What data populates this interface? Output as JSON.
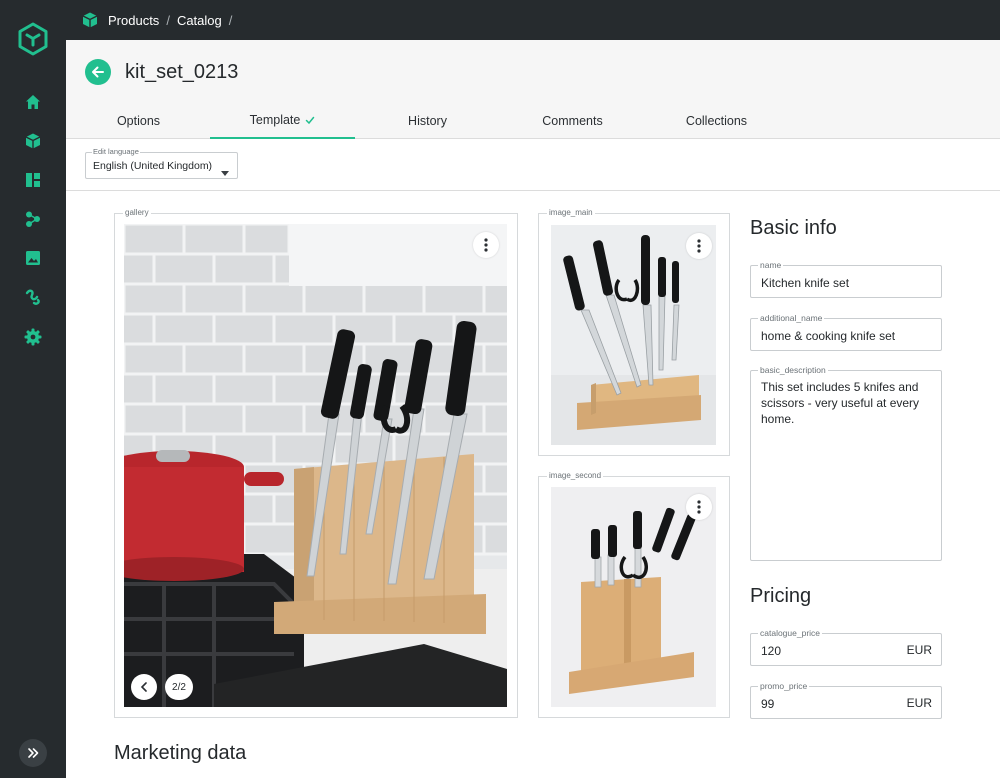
{
  "colors": {
    "sidebar": "#262b2e",
    "accent": "#21bf8f"
  },
  "sidebar": {
    "logo": "cube-logo-icon",
    "items": [
      {
        "icon": "home-icon"
      },
      {
        "icon": "products-cube-icon"
      },
      {
        "icon": "dashboard-icon"
      },
      {
        "icon": "workflow-icon"
      },
      {
        "icon": "image-icon"
      },
      {
        "icon": "integrations-icon"
      },
      {
        "icon": "settings-gear-icon"
      }
    ],
    "expand_icon": "double-chevron-right-icon"
  },
  "breadcrumb": {
    "items": [
      "Products",
      "Catalog"
    ],
    "separator": "/"
  },
  "header": {
    "title": "kit_set_0213"
  },
  "tabs": [
    {
      "label": "Options"
    },
    {
      "label": "Template"
    },
    {
      "label": "History"
    },
    {
      "label": "Comments"
    },
    {
      "label": "Collections"
    }
  ],
  "language": {
    "label": "Edit language",
    "value": "English (United Kingdom)"
  },
  "gallery": {
    "label": "gallery",
    "counter": "2/2"
  },
  "image_main": {
    "label": "image_main"
  },
  "image_second": {
    "label": "image_second"
  },
  "basic_info": {
    "title": "Basic info",
    "name": {
      "label": "name",
      "value": "Kitchen knife set"
    },
    "additional_name": {
      "label": "additional_name",
      "value": "home & cooking knife set"
    },
    "basic_description": {
      "label": "basic_description",
      "value": "This set includes 5 knifes and scissors - very useful at every home."
    }
  },
  "pricing": {
    "title": "Pricing",
    "catalogue_price": {
      "label": "catalogue_price",
      "value": "120",
      "currency": "EUR"
    },
    "promo_price": {
      "label": "promo_price",
      "value": "99",
      "currency": "EUR"
    }
  },
  "marketing": {
    "title": "Marketing data"
  }
}
